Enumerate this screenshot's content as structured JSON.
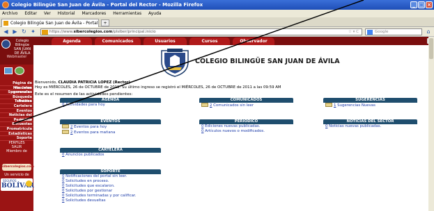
{
  "browser": {
    "window_title": "Colegio Bilingüe San Juan de Ávila - Portal del Rector - Mozilla Firefox",
    "menu": [
      "Archivo",
      "Editar",
      "Ver",
      "Historial",
      "Marcadores",
      "Herramientas",
      "Ayuda"
    ],
    "tab_title": "Colegio Bilingüe San Juan de Ávila - Portal d...",
    "new_tab": "+",
    "url_prefix": "https://www.",
    "url_domain": "sibercolegios.com",
    "url_suffix": "/plsiber/principal.inicio",
    "search_placeholder": "Google"
  },
  "sidebar": {
    "title": "Colegio Bilingüe SAN JUAN DE ÁVILA",
    "subtitle": "Webmaster",
    "items": [
      "Página de resumen",
      "Mis datos personales",
      "Sugerencias",
      "Búsqueda Temática",
      "Recreo",
      "Cartelera",
      "Eventos",
      "Noticias del sector",
      "Periódico",
      "Encuestas",
      "Promatricula",
      "Estadísticas",
      "Soporte"
    ],
    "perfiles": "PERFILES",
    "salir": "SALIR",
    "miembro": "Miembro de",
    "network": "sibercolegios.com",
    "servicio": "Un servicio de",
    "seguros": "SEGUROS",
    "bolivar": "BOLÍVAR"
  },
  "topnav": [
    "Agenda",
    "Comunicados",
    "Usuarios",
    "Cursos",
    "Observador"
  ],
  "header": {
    "school_name": "COLEGIO BILINGÜE SAN JUAN DE ÁVILA"
  },
  "welcome": {
    "line1_prefix": "Bienvenido, ",
    "user": "CLAUDIA PATRICIA LOPEZ ",
    "role": "(Rector)",
    "line2": "Hoy es MIÉRCOLES, 26 de OCTUBRE de 2011. Su último ingreso se registró el MIÉRCOLES, 26 de OCTUBRE de 2011 a las 09:59 AM"
  },
  "summary_text": "Este es el resumen de las actividades pendientes:",
  "panels": {
    "agenda": {
      "title": "AGENDA",
      "rows": [
        {
          "n": "0",
          "t": "Actividades para hoy"
        }
      ]
    },
    "comunicados": {
      "title": "COMUNICADOS",
      "rows": [
        {
          "n": "2",
          "t": "Comunicados sin leer"
        }
      ]
    },
    "sugerencias": {
      "title": "SUGERENCIAS",
      "rows": [
        {
          "n": "1",
          "t": "Sugerencias Nuevas"
        }
      ]
    },
    "eventos": {
      "title": "EVENTOS",
      "rows": [
        {
          "n": "2",
          "t": "Eventos para hoy"
        },
        {
          "n": "2",
          "t": "Eventos para mañana"
        }
      ]
    },
    "periodico": {
      "title": "PERIÓDICO",
      "rows": [
        {
          "n": "0",
          "t": "Ediciones nuevas publicadas."
        },
        {
          "n": "0",
          "t": "Artículos nuevos o modificados."
        }
      ]
    },
    "noticias": {
      "title": "NOTICIAS DEL SECTOR",
      "rows": [
        {
          "n": "0",
          "t": "Noticias nuevas publicadas."
        }
      ]
    },
    "cartelera": {
      "title": "CARTELERA",
      "rows": [
        {
          "n": "0",
          "t": "Anuncios publicados"
        }
      ]
    },
    "soporte": {
      "title": "SOPORTE",
      "rows": [
        {
          "n": "0",
          "t": "Notificaciones del portal sin leer."
        },
        {
          "n": "0",
          "t": "Solicitudes en proceso."
        },
        {
          "n": "0",
          "t": "Solicitudes que escalaron."
        },
        {
          "n": "0",
          "t": "Solicitudes por gestionar"
        },
        {
          "n": "0",
          "t": "Solicitudes terminadas y por calificar."
        },
        {
          "n": "0",
          "t": "Solicitudes devueltas"
        }
      ]
    }
  }
}
